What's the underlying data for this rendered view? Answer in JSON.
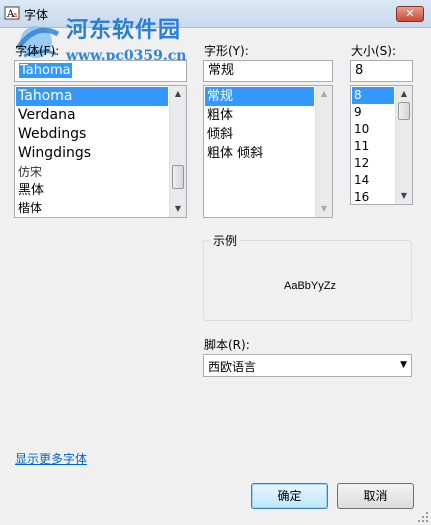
{
  "window": {
    "title": "字体",
    "close_glyph": "✕"
  },
  "watermark": {
    "brand": "河东软件园",
    "url": "www.pc0359.cn"
  },
  "font": {
    "label": "字体(F):",
    "value": "Tahoma",
    "items": [
      "Tahoma",
      "Verdana",
      "Webdings",
      "Wingdings",
      "仿宋",
      "黑体",
      "楷体"
    ],
    "selected_index": 0
  },
  "style": {
    "label": "字形(Y):",
    "value": "常规",
    "items": [
      "常规",
      "粗体",
      "倾斜",
      "粗体 倾斜"
    ],
    "selected_index": 0
  },
  "size": {
    "label": "大小(S):",
    "value": "8",
    "items": [
      "8",
      "9",
      "10",
      "11",
      "12",
      "14",
      "16"
    ],
    "selected_index": 0
  },
  "sample": {
    "title": "示例",
    "text": "AaBbYyZz"
  },
  "script": {
    "label": "脚本(R):",
    "value": "西欧语言"
  },
  "more_fonts_link": "显示更多字体",
  "buttons": {
    "ok": "确定",
    "cancel": "取消"
  },
  "icons": {
    "arrow_up": "▲",
    "arrow_down": "▼"
  },
  "colors": {
    "selection": "#3399ff",
    "link": "#0066cc",
    "watermark": "#2a7fd4"
  }
}
